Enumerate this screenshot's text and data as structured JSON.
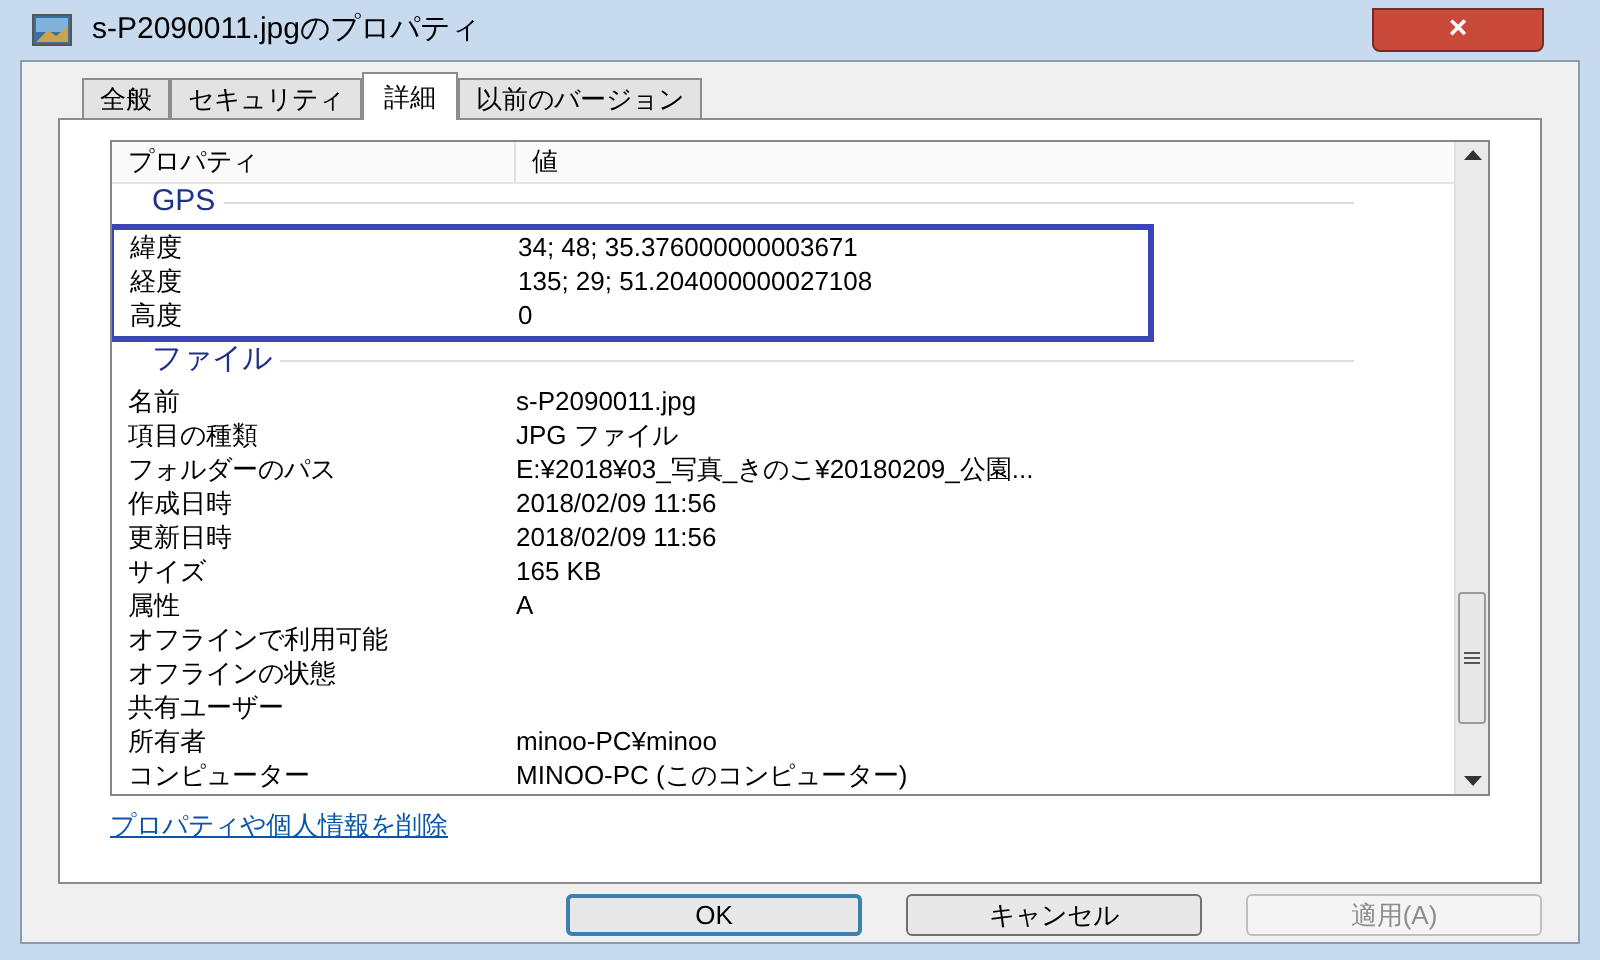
{
  "window": {
    "title": "s-P2090011.jpgのプロパティ",
    "close": "×"
  },
  "tabs": [
    {
      "label": "全般",
      "selected": false
    },
    {
      "label": "セキュリティ",
      "selected": false
    },
    {
      "label": "詳細",
      "selected": true
    },
    {
      "label": "以前のバージョン",
      "selected": false
    }
  ],
  "list": {
    "columns": [
      "プロパティ",
      "値"
    ],
    "groups": [
      {
        "name": "GPS",
        "highlighted": true,
        "rows": [
          {
            "property": "緯度",
            "value": "34; 48; 35.376000000003671"
          },
          {
            "property": "経度",
            "value": "135; 29; 51.204000000027108"
          },
          {
            "property": "高度",
            "value": "0"
          }
        ]
      },
      {
        "name": "ファイル",
        "highlighted": false,
        "rows": [
          {
            "property": "名前",
            "value": "s-P2090011.jpg"
          },
          {
            "property": "項目の種類",
            "value": "JPG ファイル"
          },
          {
            "property": "フォルダーのパス",
            "value": "E:¥2018¥03_写真_きのこ¥20180209_公園..."
          },
          {
            "property": "作成日時",
            "value": "2018/02/09 11:56"
          },
          {
            "property": "更新日時",
            "value": "2018/02/09 11:56"
          },
          {
            "property": "サイズ",
            "value": "165 KB"
          },
          {
            "property": "属性",
            "value": "A"
          },
          {
            "property": "オフラインで利用可能"
          },
          {
            "property": "オフラインの状態"
          },
          {
            "property": "共有ユーザー"
          },
          {
            "property": "所有者",
            "value": "minoo-PC¥minoo"
          },
          {
            "property": "コンピューター",
            "value": "MINOO-PC (このコンピューター)"
          }
        ]
      }
    ]
  },
  "link": "プロパティや個人情報を削除",
  "buttons": [
    {
      "label": "OK",
      "disabled": false,
      "default": true
    },
    {
      "label": "キャンセル",
      "disabled": false,
      "default": false
    },
    {
      "label": "適用(A)",
      "disabled": true,
      "default": false
    }
  ]
}
